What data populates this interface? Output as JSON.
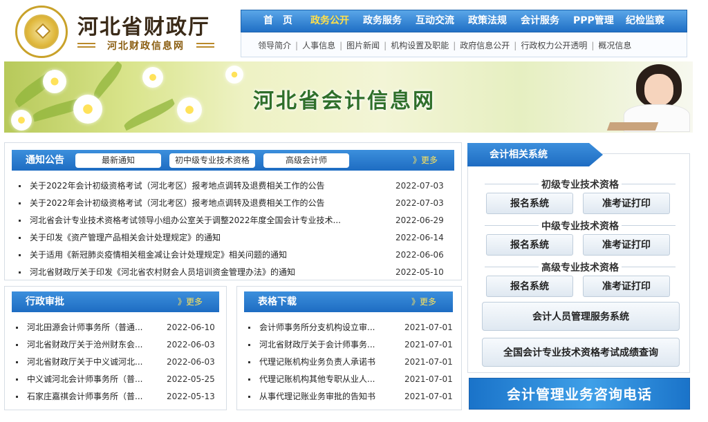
{
  "header": {
    "site_title": "河北省财政厅",
    "site_subtitle": "河北财政信息网",
    "main_nav": [
      "首　页",
      "政务公开",
      "政务服务",
      "互动交流",
      "政策法规",
      "会计服务",
      "PPP管理",
      "纪检监察"
    ],
    "active_nav": "政务公开",
    "sub_nav": [
      "领导简介",
      "人事信息",
      "图片新闻",
      "机构设置及职能",
      "政府信息公开",
      "行政权力公开透明",
      "概况信息"
    ]
  },
  "banner": {
    "title": "河北省会计信息网"
  },
  "notice": {
    "title": "通知公告",
    "tabs": [
      "最新通知",
      "初中级专业技术资格",
      "高级会计师"
    ],
    "more": "》更多",
    "items": [
      {
        "text": "关于2022年会计初级资格考试（河北考区）报考地点调转及退费相关工作的公告",
        "date": "2022-07-03"
      },
      {
        "text": "关于2022年会计初级资格考试（河北考区）报考地点调转及退费相关工作的公告",
        "date": "2022-07-03"
      },
      {
        "text": "河北省会计专业技术资格考试领导小组办公室关于调整2022年度全国会计专业技术...",
        "date": "2022-06-29"
      },
      {
        "text": "关于印发《资产管理产品相关会计处理规定》的通知",
        "date": "2022-06-14"
      },
      {
        "text": "关于适用《新冠肺炎疫情相关租金减让会计处理规定》相关问题的通知",
        "date": "2022-06-06"
      },
      {
        "text": "河北省财政厅关于印发《河北省农村财会人员培训资金管理办法》的通知",
        "date": "2022-05-10"
      }
    ]
  },
  "approval": {
    "title": "行政审批",
    "more": "》更多",
    "items": [
      {
        "text": "河北田源会计师事务所（普通...",
        "date": "2022-06-10"
      },
      {
        "text": "河北省财政厅关于沧州财东会...",
        "date": "2022-06-03"
      },
      {
        "text": "河北省财政厅关于中义诚河北...",
        "date": "2022-06-03"
      },
      {
        "text": "中义诚河北会计师事务所（普...",
        "date": "2022-05-25"
      },
      {
        "text": "石家庄嘉祺会计师事务所（普...",
        "date": "2022-05-13"
      }
    ]
  },
  "forms": {
    "title": "表格下载",
    "more": "》更多",
    "items": [
      {
        "text": "会计师事务所分支机构设立审...",
        "date": "2021-07-01"
      },
      {
        "text": "河北省财政厅关于会计师事务...",
        "date": "2021-07-01"
      },
      {
        "text": "代理记账机构业务负责人承诺书",
        "date": "2021-07-01"
      },
      {
        "text": "代理记账机构其他专职从业人...",
        "date": "2021-07-01"
      },
      {
        "text": "从事代理记账业务审批的告知书",
        "date": "2021-07-01"
      }
    ]
  },
  "systems": {
    "title": "会计相关系统",
    "groups": [
      {
        "title": "初级专业技术资格",
        "register": "报名系统",
        "ticket": "准考证打印"
      },
      {
        "title": "中级专业技术资格",
        "register": "报名系统",
        "ticket": "准考证打印"
      },
      {
        "title": "高级专业技术资格",
        "register": "报名系统",
        "ticket": "准考证打印"
      }
    ],
    "personnel": "会计人员管理服务系统",
    "score_query": "全国会计专业技术资格考试成绩查询"
  },
  "hotline": "会计管理业务咨询电话",
  "colors": {
    "brand_blue": "#1e6cc2",
    "active_yellow": "#ffe04a",
    "seal_gold": "#c9a22a"
  }
}
